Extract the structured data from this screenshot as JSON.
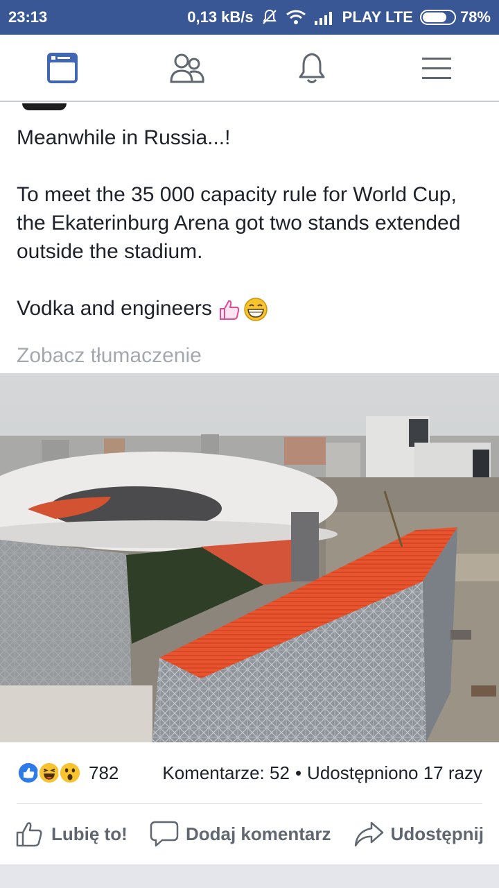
{
  "status_bar": {
    "time": "23:13",
    "speed": "0,13 kB/s",
    "carrier": "PLAY LTE",
    "battery": "78%",
    "battery_level": 0.78
  },
  "nav": {
    "items": [
      {
        "icon": "news-feed-icon",
        "active": true
      },
      {
        "icon": "friends-icon",
        "active": false
      },
      {
        "icon": "notifications-bell-icon",
        "active": false
      },
      {
        "icon": "menu-icon",
        "active": false
      }
    ],
    "active_color": "#4267b2"
  },
  "post": {
    "line1": "Meanwhile in Russia...!",
    "line2": "To meet the 35 000 capacity rule for World Cup, the Ekaterinburg Arena got two stands extended outside the stadium.",
    "line3": "Vodka and engineers",
    "emojis": [
      "thumbs-up-icon",
      "grinning-face-icon"
    ],
    "translate": "Zobacz tłumaczenie"
  },
  "reactions": {
    "icons": [
      "like-reaction-icon",
      "haha-reaction-icon",
      "wow-reaction-icon"
    ],
    "count": "782"
  },
  "stats": {
    "comments": "Komentarze: 52",
    "separator": "•",
    "shares": "Udostępniono 17 razy"
  },
  "actions": {
    "like": "Lubię to!",
    "comment": "Dodaj komentarz",
    "share": "Udostępnij"
  }
}
